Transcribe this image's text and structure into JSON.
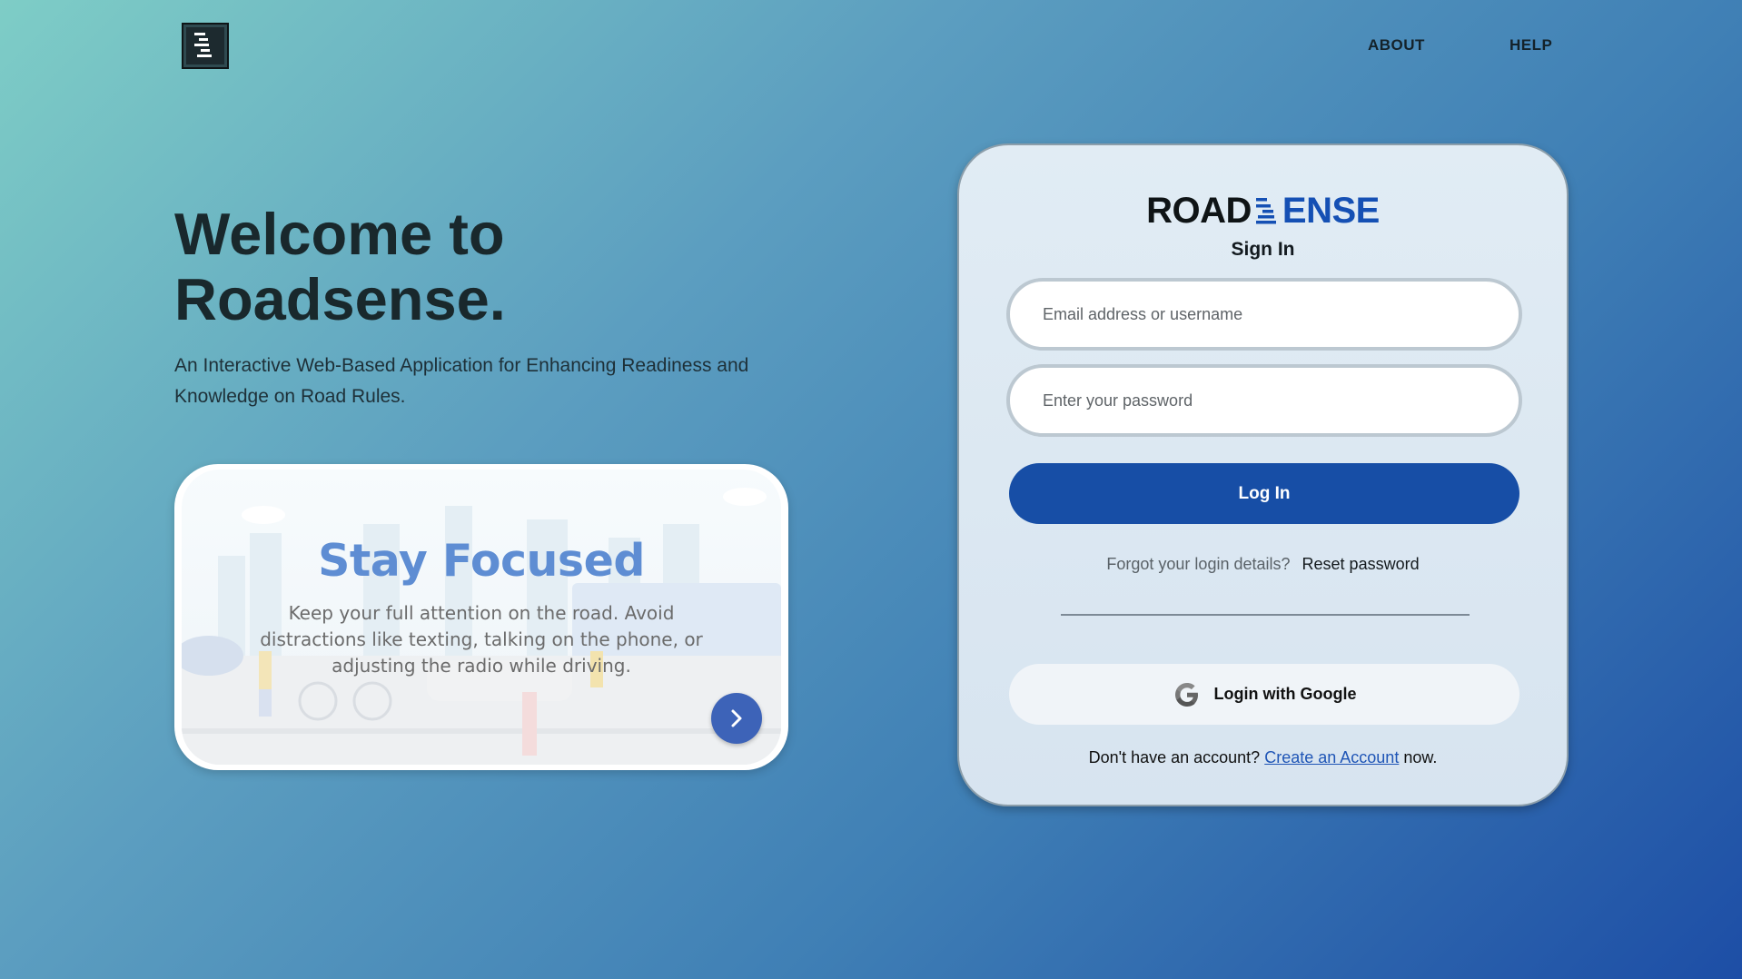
{
  "header": {
    "logo_icon": "roadsense-logo-icon",
    "nav": [
      {
        "label": "ABOUT"
      },
      {
        "label": "HELP"
      }
    ]
  },
  "hero": {
    "title_line1": "Welcome to",
    "title_line2": "Roadsense.",
    "subtitle": "An Interactive Web-Based Application for Enhancing Readiness and Knowledge on Road Rules."
  },
  "carousel": {
    "slide_title": "Stay Focused",
    "slide_body": "Keep your full attention on the road. Avoid distractions like texting, talking on the phone, or adjusting the radio while driving.",
    "next_icon": "chevron-right-icon"
  },
  "signin": {
    "brand_left": "ROAD",
    "brand_right": "ENSE",
    "heading": "Sign In",
    "email_placeholder": "Email address or username",
    "password_placeholder": "Enter your password",
    "login_label": "Log In",
    "forgot_text": "Forgot your login details?",
    "reset_label": "Reset password",
    "google_label": "Login with Google",
    "signup_prefix": "Don't have an account?",
    "signup_link": "Create an Account",
    "signup_suffix": "now."
  },
  "colors": {
    "primary": "#174ea6",
    "brand_blue": "#1550b4",
    "carousel_title": "#5e8dd3",
    "link": "#1f55b6"
  }
}
